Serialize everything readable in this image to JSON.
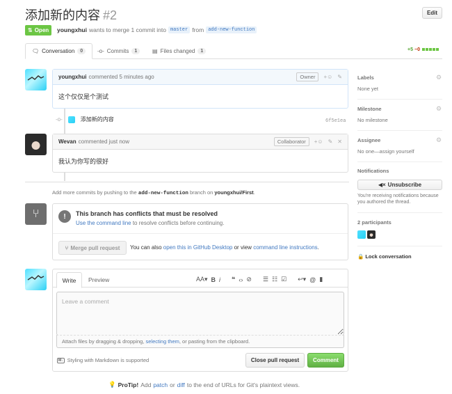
{
  "header": {
    "title": "添加新的内容",
    "number": "#2",
    "edit_label": "Edit",
    "state_label": "Open",
    "author": "youngxhui",
    "merge_text": "wants to merge 1 commit into",
    "base_branch": "master",
    "from_text": "from",
    "head_branch": "add-new-function"
  },
  "tabs": [
    {
      "label": "Conversation",
      "count": "0"
    },
    {
      "label": "Commits",
      "count": "1"
    },
    {
      "label": "Files changed",
      "count": "1"
    }
  ],
  "diffstat": {
    "additions": "+5",
    "deletions": "−0"
  },
  "comments": [
    {
      "author": "youngxhui",
      "time": "commented 5 minutes ago",
      "role": "Owner",
      "body": "这个仅仅是个测试"
    },
    {
      "author": "Wevan",
      "time": "commented just now",
      "role": "Collaborator",
      "body": "我认为你写的很好"
    }
  ],
  "commit": {
    "message": "添加新的内容",
    "sha": "6f5e1ea"
  },
  "push_hint": {
    "prefix": "Add more commits by pushing to the",
    "branch": "add-new-function",
    "middle": "branch on",
    "repo": "youngxhui/First",
    "suffix": "."
  },
  "merge": {
    "conflict_title": "This branch has conflicts that must be resolved",
    "conflict_link": "Use the command line",
    "conflict_rest": "to resolve conflicts before continuing.",
    "button_label": "Merge pull request",
    "alt_prefix": "You can also",
    "alt_link1": "open this in GitHub Desktop",
    "alt_middle": "or view",
    "alt_link2": "command line instructions",
    "alt_suffix": "."
  },
  "composer": {
    "tab_write": "Write",
    "tab_preview": "Preview",
    "placeholder": "Leave a comment",
    "attach_prefix": "Attach files by dragging & dropping,",
    "attach_link": "selecting them",
    "attach_suffix": ", or pasting from the clipboard.",
    "markdown_hint": "Styling with Markdown is supported",
    "close_label": "Close pull request",
    "comment_label": "Comment"
  },
  "protip": {
    "label": "ProTip!",
    "prefix": "Add",
    "link1": "patch",
    "middle": "or",
    "link2": "diff",
    "suffix": "to the end of URLs for Git's plaintext views."
  },
  "sidebar": {
    "labels_title": "Labels",
    "labels_value": "None yet",
    "milestone_title": "Milestone",
    "milestone_value": "No milestone",
    "assignee_title": "Assignee",
    "assignee_value": "No one—assign yourself",
    "notifications_title": "Notifications",
    "unsubscribe_label": "Unsubscribe",
    "notif_reason": "You're receiving notifications because you authored the thread.",
    "participants_title": "2 participants",
    "lock_label": "Lock conversation"
  },
  "colors": {
    "open": "#6cc644",
    "link": "#4078c0",
    "comment_green": "#60b044"
  }
}
